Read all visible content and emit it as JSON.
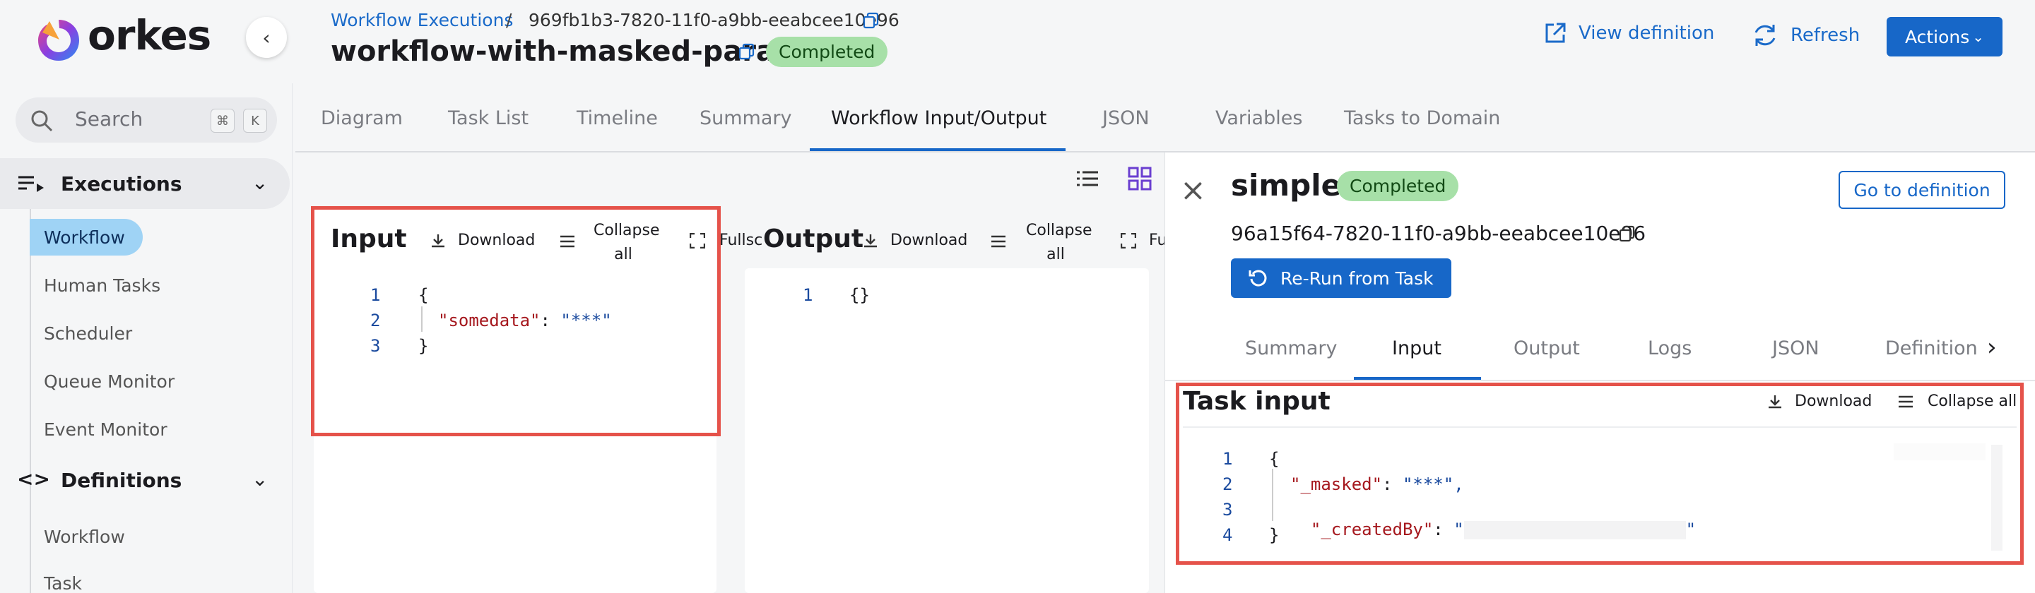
{
  "brand": {
    "name": "orkes",
    "accent": "#1767c8"
  },
  "header": {
    "breadcrumb_root": "Workflow Executions",
    "breadcrumb_sep": "/",
    "workflow_id": "969fb1b3-7820-11f0-a9bb-eeabcee10e96",
    "title": "workflow-with-masked-param",
    "status": "Completed",
    "view_definition": "View definition",
    "refresh": "Refresh",
    "actions": "Actions"
  },
  "sidebar": {
    "search_placeholder": "Search",
    "shortcut_keys": [
      "⌘",
      "K"
    ],
    "executions_label": "Executions",
    "executions_items": [
      "Workflow",
      "Human Tasks",
      "Scheduler",
      "Queue Monitor",
      "Event Monitor"
    ],
    "definitions_label": "Definitions",
    "definitions_items": [
      "Workflow",
      "Task"
    ]
  },
  "tabs": [
    "Diagram",
    "Task List",
    "Timeline",
    "Summary",
    "Workflow Input/Output",
    "JSON",
    "Variables",
    "Tasks to Domain"
  ],
  "active_tab": "Workflow Input/Output",
  "input_panel": {
    "title": "Input",
    "download": "Download",
    "collapse_line1": "Collapse",
    "collapse_line2": "all",
    "fullscreen": "Fullscreen",
    "lines": [
      {
        "num": "1",
        "text": "{"
      },
      {
        "num": "2",
        "key": "\"somedata\"",
        "sep": ": ",
        "val": "\"***\""
      },
      {
        "num": "3",
        "text": "}"
      }
    ]
  },
  "output_panel": {
    "title": "Output",
    "download": "Download",
    "collapse_line1": "Collapse",
    "collapse_line2": "all",
    "fullscreen": "Fu",
    "lines": [
      {
        "num": "1",
        "text": "{}"
      }
    ]
  },
  "task_drawer": {
    "task_name": "simple",
    "status": "Completed",
    "go_to_definition": "Go to definition",
    "task_id": "96a15f64-7820-11f0-a9bb-eeabcee10e96",
    "rerun": "Re-Run from Task",
    "tabs": [
      "Summary",
      "Input",
      "Output",
      "Logs",
      "JSON",
      "Definition"
    ],
    "active_tab": "Input",
    "panel_title": "Task input",
    "download": "Download",
    "collapse_all": "Collapse all",
    "lines": [
      {
        "num": "1",
        "text": "{"
      },
      {
        "num": "2",
        "key": "\"_masked\"",
        "sep": ": ",
        "val": "\"***\","
      },
      {
        "num": "3",
        "key": "\"_createdBy\"",
        "sep": ": ",
        "val_open": "\"",
        "val_close": "\""
      },
      {
        "num": "4",
        "text": "}"
      }
    ]
  }
}
